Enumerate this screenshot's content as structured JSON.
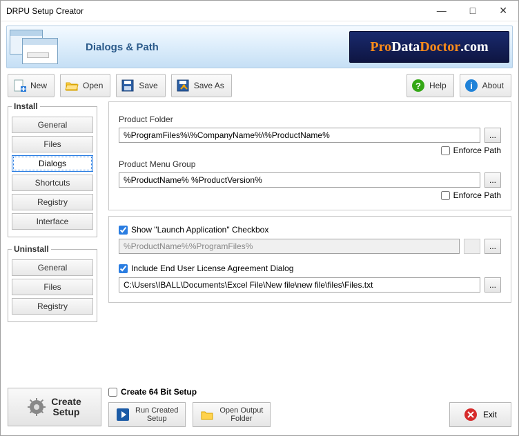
{
  "window_title": "DRPU Setup Creator",
  "header": {
    "title": "Dialogs & Path",
    "brand_pro": "Pro",
    "brand_data": "Data",
    "brand_doctor": "Doctor",
    "brand_com": ".com"
  },
  "toolbar": {
    "new": "New",
    "open": "Open",
    "save": "Save",
    "saveas": "Save As",
    "help": "Help",
    "about": "About"
  },
  "sidebar": {
    "install_title": "Install",
    "install_items": [
      "General",
      "Files",
      "Dialogs",
      "Shortcuts",
      "Registry",
      "Interface"
    ],
    "uninstall_title": "Uninstall",
    "uninstall_items": [
      "General",
      "Files",
      "Registry"
    ]
  },
  "panel1": {
    "product_folder_label": "Product Folder",
    "product_folder_value": "%ProgramFiles%\\%CompanyName%\\%ProductName%",
    "product_menu_label": "Product Menu Group",
    "product_menu_value": "%ProductName% %ProductVersion%",
    "enforce_path": "Enforce Path",
    "browse": "..."
  },
  "panel2": {
    "show_launch": "Show \"Launch Application\" Checkbox",
    "launch_value": "%ProductName%%ProgramFiles%",
    "include_eula": "Include End User License Agreement Dialog",
    "eula_value": "C:\\Users\\IBALL\\Documents\\Excel File\\New file\\new file\\files\\Files.txt",
    "browse": "..."
  },
  "footer": {
    "create_setup": "Create\nSetup",
    "create64": "Create 64 Bit Setup",
    "run_created": "Run Created\nSetup",
    "open_output": "Open Output\nFolder",
    "exit": "Exit"
  }
}
